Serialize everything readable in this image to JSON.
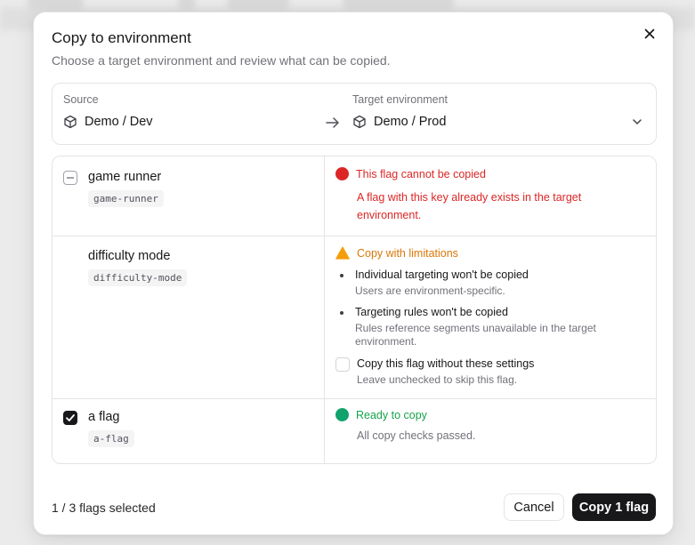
{
  "dialog": {
    "title": "Copy to environment",
    "description": "Choose a target environment and review what can be copied.",
    "close_icon": "close-icon"
  },
  "environments": {
    "source_label": "Source",
    "source_value": "Demo / Dev",
    "target_label": "Target environment",
    "target_value": "Demo / Prod",
    "env_icon": "cube-icon",
    "arrow_icon": "arrow-right-icon",
    "dropdown_icon": "chevron-down-icon"
  },
  "flags": [
    {
      "name": "game runner",
      "key": "game-runner",
      "checkbox_state": "indeterminate",
      "status": {
        "type": "error",
        "color": "#dc2626",
        "label": "This flag cannot be copied",
        "detail_line1": "A flag with this key already exists in the target",
        "detail_line2": "environment."
      }
    },
    {
      "name": "difficulty mode",
      "key": "difficulty-mode",
      "checkbox_state": "none",
      "status": {
        "type": "warning",
        "color": "#f59e0b",
        "label_color": "#d97706",
        "label": "Copy with limitations",
        "limitations": [
          {
            "title": "Individual targeting won't be copied",
            "subtitle_line1": "Users are environment-specific.",
            "subtitle_line2": ""
          },
          {
            "title": "Targeting rules won't be copied",
            "subtitle_line1": "Rules reference segments unavailable in the target",
            "subtitle_line2": "environment."
          }
        ],
        "option_label": "Copy this flag without these settings",
        "option_hint": "Leave unchecked to skip this flag.",
        "option_checked": false
      }
    },
    {
      "name": "a flag",
      "key": "a-flag",
      "checkbox_state": "checked",
      "status": {
        "type": "success",
        "color": "#16a34a",
        "dot_color": "#10a36b",
        "label": "Ready to copy",
        "detail_line1": "All copy checks passed."
      }
    }
  ],
  "footer": {
    "selection_count": "1 / 3 flags selected",
    "cancel_label": "Cancel",
    "copy_label": "Copy 1 flag"
  }
}
